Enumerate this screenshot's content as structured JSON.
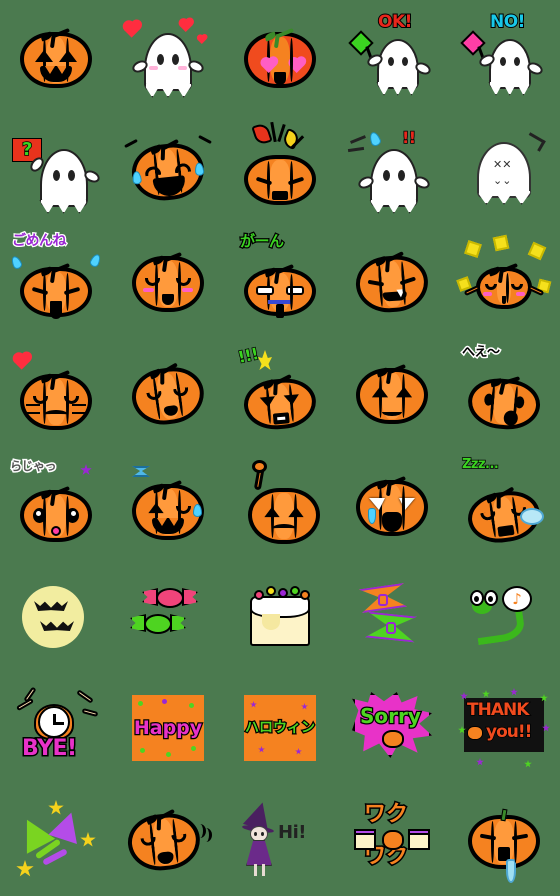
{
  "page": {
    "title": "Halloween Pumpkin & Ghost Emoji Set",
    "background_color": "#4b7a4f",
    "grid": {
      "columns": 5,
      "rows": 8,
      "cell_size_px": 112,
      "total_stickers": 40
    }
  },
  "palette": {
    "pumpkin_orange": "#f58220",
    "pumpkin_highlight": "#ff9a3c",
    "outline_black": "#000000",
    "ghost_white": "#ffffff",
    "heart_red": "#ff2d3f",
    "heart_pink": "#ff5ec4",
    "ok_red": "#e8271c",
    "no_cyan": "#18c8e8",
    "green_accent": "#3bd421",
    "purple_accent": "#9b27d4",
    "magenta_accent": "#e832c8",
    "yellow_accent": "#f5e01c",
    "moon_yellow": "#f2eda0",
    "tear_blue": "#4fd2ff"
  },
  "stickers": [
    {
      "id": 1,
      "row": 1,
      "col": 1,
      "name": "jack-o-lantern-classic-smile",
      "kind": "pumpkin",
      "label": ""
    },
    {
      "id": 2,
      "row": 1,
      "col": 2,
      "name": "ghost-in-love-hearts",
      "kind": "ghost",
      "label": ""
    },
    {
      "id": 3,
      "row": 1,
      "col": 3,
      "name": "pumpkin-heart-eyes",
      "kind": "pumpkin",
      "label": ""
    },
    {
      "id": 4,
      "row": 1,
      "col": 4,
      "name": "ghost-holding-ok-sign",
      "kind": "ghost",
      "label": "OK!"
    },
    {
      "id": 5,
      "row": 1,
      "col": 5,
      "name": "ghost-holding-no-sign",
      "kind": "ghost",
      "label": "NO!"
    },
    {
      "id": 6,
      "row": 2,
      "col": 1,
      "name": "ghost-with-question-card",
      "kind": "ghost",
      "label": "?"
    },
    {
      "id": 7,
      "row": 2,
      "col": 2,
      "name": "pumpkin-laughing-tears",
      "kind": "pumpkin",
      "label": ""
    },
    {
      "id": 8,
      "row": 2,
      "col": 3,
      "name": "pumpkin-angry-explosion",
      "kind": "pumpkin",
      "label": ""
    },
    {
      "id": 9,
      "row": 2,
      "col": 4,
      "name": "ghost-startled-exclamation",
      "kind": "ghost",
      "label": "!!"
    },
    {
      "id": 10,
      "row": 2,
      "col": 5,
      "name": "ghost-sketchy-gloomy",
      "kind": "ghost",
      "label": ""
    },
    {
      "id": 11,
      "row": 3,
      "col": 1,
      "name": "pumpkin-sorry-gomenne",
      "kind": "pumpkin",
      "label": "ごめんね"
    },
    {
      "id": 12,
      "row": 3,
      "col": 2,
      "name": "pumpkin-happy-blush-smile",
      "kind": "pumpkin",
      "label": ""
    },
    {
      "id": 13,
      "row": 3,
      "col": 3,
      "name": "pumpkin-shocked-gaan",
      "kind": "pumpkin",
      "label": "がーん"
    },
    {
      "id": 14,
      "row": 3,
      "col": 4,
      "name": "pumpkin-smirking-fang",
      "kind": "pumpkin",
      "label": ""
    },
    {
      "id": 15,
      "row": 3,
      "col": 5,
      "name": "pumpkin-delighted-sparkles",
      "kind": "pumpkin",
      "label": ""
    },
    {
      "id": 16,
      "row": 4,
      "col": 1,
      "name": "pumpkin-shy-heart-blush",
      "kind": "pumpkin",
      "label": ""
    },
    {
      "id": 17,
      "row": 4,
      "col": 2,
      "name": "pumpkin-sleepy-dozing",
      "kind": "pumpkin",
      "label": ""
    },
    {
      "id": 18,
      "row": 4,
      "col": 3,
      "name": "pumpkin-furious-anger-marks",
      "kind": "pumpkin",
      "label": "!!!"
    },
    {
      "id": 19,
      "row": 4,
      "col": 4,
      "name": "pumpkin-worried-frown",
      "kind": "pumpkin",
      "label": ""
    },
    {
      "id": 20,
      "row": 4,
      "col": 5,
      "name": "pumpkin-surprised-hee",
      "kind": "pumpkin",
      "label": "へえ〜"
    },
    {
      "id": 21,
      "row": 5,
      "col": 1,
      "name": "pumpkin-cute-roger-rajaa",
      "kind": "pumpkin",
      "label": "らじゃっ"
    },
    {
      "id": 22,
      "row": 5,
      "col": 2,
      "name": "pumpkin-wink-ribbon-smile",
      "kind": "pumpkin",
      "label": ""
    },
    {
      "id": 23,
      "row": 5,
      "col": 3,
      "name": "pumpkin-raising-hand",
      "kind": "pumpkin",
      "label": ""
    },
    {
      "id": 24,
      "row": 5,
      "col": 4,
      "name": "pumpkin-crying-sad",
      "kind": "pumpkin",
      "label": ""
    },
    {
      "id": 25,
      "row": 5,
      "col": 5,
      "name": "pumpkin-sleeping-zzz",
      "kind": "pumpkin",
      "label": "Zzz..."
    },
    {
      "id": 26,
      "row": 6,
      "col": 1,
      "name": "full-moon-with-bats",
      "kind": "object",
      "label": ""
    },
    {
      "id": 27,
      "row": 6,
      "col": 2,
      "name": "wrapped-candies-pink-green",
      "kind": "object",
      "label": ""
    },
    {
      "id": 28,
      "row": 6,
      "col": 3,
      "name": "halloween-decorated-cake",
      "kind": "object",
      "label": ""
    },
    {
      "id": 29,
      "row": 6,
      "col": 4,
      "name": "ribbon-bows-orange-green",
      "kind": "object",
      "label": ""
    },
    {
      "id": 30,
      "row": 6,
      "col": 5,
      "name": "green-worm-with-music-note",
      "kind": "object",
      "label": ""
    },
    {
      "id": 31,
      "row": 7,
      "col": 1,
      "name": "alarm-clock-bye-text",
      "kind": "text-sticker",
      "label": "BYE!"
    },
    {
      "id": 32,
      "row": 7,
      "col": 2,
      "name": "happy-card-orange",
      "kind": "text-card",
      "label": "Happy"
    },
    {
      "id": 33,
      "row": 7,
      "col": 3,
      "name": "halloween-card-katakana",
      "kind": "text-card",
      "label": "ハロウィン"
    },
    {
      "id": 34,
      "row": 7,
      "col": 4,
      "name": "sorry-burst-sticker",
      "kind": "text-sticker",
      "label": "Sorry"
    },
    {
      "id": 35,
      "row": 7,
      "col": 5,
      "name": "thank-you-confetti-sticker",
      "kind": "text-sticker",
      "label": "THANK you!!"
    },
    {
      "id": 36,
      "row": 8,
      "col": 1,
      "name": "party-hats-and-stars",
      "kind": "object",
      "label": ""
    },
    {
      "id": 37,
      "row": 8,
      "col": 2,
      "name": "pumpkin-shaking-head-no",
      "kind": "pumpkin",
      "label": ""
    },
    {
      "id": 38,
      "row": 8,
      "col": 3,
      "name": "witch-girl-saying-hi",
      "kind": "character",
      "label": "Hi!"
    },
    {
      "id": 39,
      "row": 8,
      "col": 4,
      "name": "wakuwaku-excited-cakes",
      "kind": "text-sticker",
      "label": "ワクワク"
    },
    {
      "id": 40,
      "row": 8,
      "col": 5,
      "name": "pumpkin-drooling-hungry",
      "kind": "pumpkin",
      "label": ""
    }
  ],
  "text_labels": {
    "ok": "OK!",
    "no": "NO!",
    "question": "?",
    "exclaim2": "!!",
    "exclaim3": "!!!",
    "gomenne": "ごめんね",
    "gaan": "がーん",
    "hee": "へえ〜",
    "rajaa": "らじゃっ",
    "zzz": "Zzz...",
    "bye": "BYE!",
    "happy": "Happy",
    "halloween": "ハロウィン",
    "sorry": "Sorry",
    "thank": "THANK",
    "you": "you!!",
    "waku1": "ワク",
    "waku2": "ワク",
    "hi": "Hi!"
  }
}
